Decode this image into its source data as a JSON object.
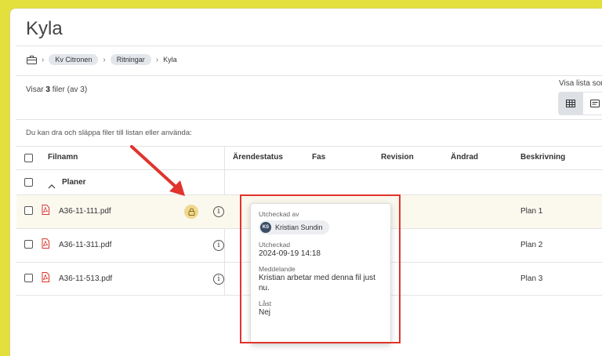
{
  "page": {
    "title": "Kyla"
  },
  "breadcrumb": {
    "home_icon": "briefcase-icon",
    "items": [
      "Kv Citronen",
      "Ritningar"
    ],
    "current": "Kyla"
  },
  "summary": {
    "prefix": "Visar",
    "count": "3",
    "suffix": "filer (av 3)"
  },
  "view": {
    "label": "Visa lista som",
    "options": [
      "table-icon",
      "list-icon"
    ]
  },
  "drop_text": "Du kan dra och släppa filer till listan eller använda:",
  "table": {
    "headers": [
      "Filnamn",
      "Ärendestatus",
      "Fas",
      "Revision",
      "Ändrad",
      "Beskrivning"
    ],
    "group": "Planer",
    "rows": [
      {
        "name": "A36-11-111.pdf",
        "description": "Plan 1",
        "locked": true
      },
      {
        "name": "A36-11-311.pdf",
        "description": "Plan 2",
        "locked": false
      },
      {
        "name": "A36-11-513.pdf",
        "description": "Plan 3",
        "locked": false
      }
    ]
  },
  "popover": {
    "checked_out_by_label": "Utcheckad av",
    "user_initials": "KS",
    "user_name": "Kristian Sundin",
    "checked_out_label": "Utcheckad",
    "checked_out_value": "2024-09-19 14:18",
    "message_label": "Meddelande",
    "message_value": "Kristian arbetar med denna fil just nu.",
    "locked_label": "Låst",
    "locked_value": "Nej"
  },
  "colors": {
    "accent_frame": "#e3df3c",
    "highlight_box": "#e0342c",
    "lock_bg": "#f0d890",
    "pdf_red": "#d9342b"
  }
}
